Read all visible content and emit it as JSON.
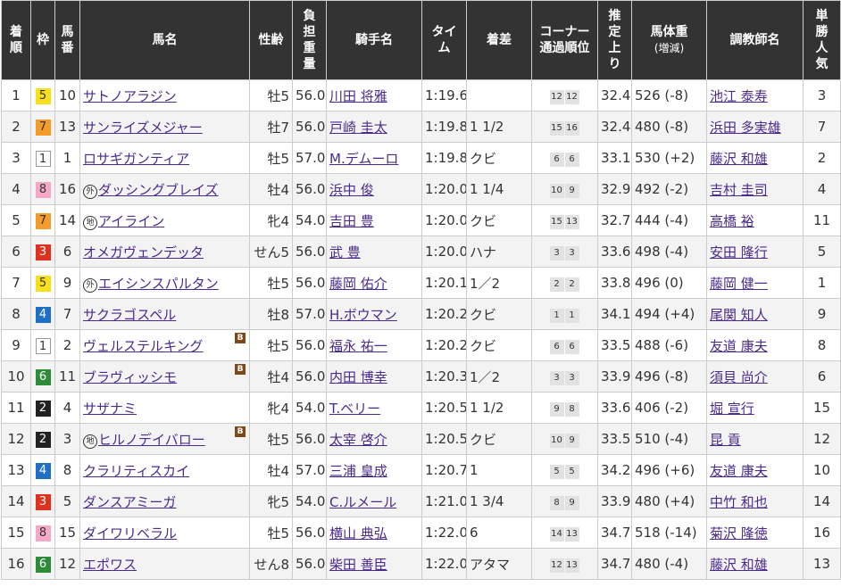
{
  "headers": {
    "rank": [
      "着",
      "順"
    ],
    "waku": [
      "枠"
    ],
    "umaban": [
      "馬",
      "番"
    ],
    "horse": [
      "馬名"
    ],
    "sexage": [
      "性齢"
    ],
    "weight": [
      "負",
      "担",
      "重",
      "量"
    ],
    "jockey": [
      "騎手名"
    ],
    "time": [
      "タイ",
      "ム"
    ],
    "margin": [
      "着差"
    ],
    "corner": [
      "コーナー",
      "通過順位"
    ],
    "last": [
      "推",
      "定",
      "上",
      "り"
    ],
    "body": [
      "馬体重",
      "(増減)"
    ],
    "trainer": [
      "調教師名"
    ],
    "pop": [
      "単",
      "勝",
      "人",
      "気"
    ]
  },
  "colors": {
    "header_bg": "#333333",
    "link": "#4b2a8c",
    "waku": {
      "1": "#ffffff",
      "2": "#222222",
      "3": "#e0301e",
      "4": "#1f6fc5",
      "5": "#f7e01a",
      "6": "#2e8b3a",
      "7": "#f39c2b",
      "8": "#f5a9c6"
    }
  },
  "rows": [
    {
      "rank": "1",
      "waku": "5",
      "umaban": "10",
      "mark": "",
      "horse": "サトノアラジン",
      "blinker": "",
      "sexage": "牡5",
      "weight": "56.0",
      "jockey": "川田 将雅",
      "time": "1:19.6",
      "margin": "",
      "corner": [
        "12",
        "12"
      ],
      "last": "32.4",
      "body": "526 (-8)",
      "trainer": "池江 泰寿",
      "pop": "3"
    },
    {
      "rank": "2",
      "waku": "7",
      "umaban": "13",
      "mark": "",
      "horse": "サンライズメジャー",
      "blinker": "",
      "sexage": "牡7",
      "weight": "56.0",
      "jockey": "戸崎 圭太",
      "time": "1:19.8",
      "margin": "1 1/2",
      "corner": [
        "15",
        "16"
      ],
      "last": "32.4",
      "body": "480 (-8)",
      "trainer": "浜田 多実雄",
      "pop": "7"
    },
    {
      "rank": "3",
      "waku": "1",
      "umaban": "1",
      "mark": "",
      "horse": "ロサギガンティア",
      "blinker": "",
      "sexage": "牡5",
      "weight": "57.0",
      "jockey": "M.デムーロ",
      "time": "1:19.8",
      "margin": "クビ",
      "corner": [
        "6",
        "6"
      ],
      "last": "33.1",
      "body": "530 (+2)",
      "trainer": "藤沢 和雄",
      "pop": "2"
    },
    {
      "rank": "4",
      "waku": "8",
      "umaban": "16",
      "mark": "外",
      "horse": "ダッシングブレイズ",
      "blinker": "",
      "sexage": "牡4",
      "weight": "56.0",
      "jockey": "浜中 俊",
      "time": "1:20.0",
      "margin": "1 1/4",
      "corner": [
        "10",
        "9"
      ],
      "last": "32.9",
      "body": "492 (-2)",
      "trainer": "吉村 圭司",
      "pop": "4"
    },
    {
      "rank": "5",
      "waku": "7",
      "umaban": "14",
      "mark": "地",
      "horse": "アイライン",
      "blinker": "",
      "sexage": "牝4",
      "weight": "54.0",
      "jockey": "吉田 豊",
      "time": "1:20.0",
      "margin": "クビ",
      "corner": [
        "15",
        "13"
      ],
      "last": "32.7",
      "body": "444 (-4)",
      "trainer": "高橋 裕",
      "pop": "11"
    },
    {
      "rank": "6",
      "waku": "3",
      "umaban": "6",
      "mark": "",
      "horse": "オメガヴェンデッタ",
      "blinker": "",
      "sexage": "せん5",
      "weight": "56.0",
      "jockey": "武 豊",
      "time": "1:20.0",
      "margin": "ハナ",
      "corner": [
        "3",
        "3"
      ],
      "last": "33.6",
      "body": "498 (-4)",
      "trainer": "安田 隆行",
      "pop": "5"
    },
    {
      "rank": "7",
      "waku": "5",
      "umaban": "9",
      "mark": "外",
      "horse": "エイシンスパルタン",
      "blinker": "",
      "sexage": "牡5",
      "weight": "56.0",
      "jockey": "藤岡 佑介",
      "time": "1:20.1",
      "margin": "1／2",
      "corner": [
        "2",
        "2"
      ],
      "last": "33.8",
      "body": "496 (0)",
      "trainer": "藤岡 健一",
      "pop": "1"
    },
    {
      "rank": "8",
      "waku": "4",
      "umaban": "7",
      "mark": "",
      "horse": "サクラゴスペル",
      "blinker": "",
      "sexage": "牡8",
      "weight": "57.0",
      "jockey": "H.ボウマン",
      "time": "1:20.2",
      "margin": "クビ",
      "corner": [
        "1",
        "1"
      ],
      "last": "34.1",
      "body": "494 (+4)",
      "trainer": "尾関 知人",
      "pop": "9"
    },
    {
      "rank": "9",
      "waku": "1",
      "umaban": "2",
      "mark": "",
      "horse": "ヴェルステルキング",
      "blinker": "B",
      "sexage": "牡5",
      "weight": "56.0",
      "jockey": "福永 祐一",
      "time": "1:20.2",
      "margin": "クビ",
      "corner": [
        "6",
        "6"
      ],
      "last": "33.5",
      "body": "488 (-6)",
      "trainer": "友道 康夫",
      "pop": "8"
    },
    {
      "rank": "10",
      "waku": "6",
      "umaban": "11",
      "mark": "",
      "horse": "ブラヴィッシモ",
      "blinker": "B",
      "sexage": "牡4",
      "weight": "56.0",
      "jockey": "内田 博幸",
      "time": "1:20.3",
      "margin": "1／2",
      "corner": [
        "3",
        "3"
      ],
      "last": "33.9",
      "body": "496 (-8)",
      "trainer": "須貝 尚介",
      "pop": "6"
    },
    {
      "rank": "11",
      "waku": "2",
      "umaban": "4",
      "mark": "",
      "horse": "サザナミ",
      "blinker": "",
      "sexage": "牝4",
      "weight": "54.0",
      "jockey": "T.ベリー",
      "time": "1:20.5",
      "margin": "1 1/2",
      "corner": [
        "9",
        "8"
      ],
      "last": "33.6",
      "body": "406 (-2)",
      "trainer": "堀 宣行",
      "pop": "15"
    },
    {
      "rank": "12",
      "waku": "2",
      "umaban": "3",
      "mark": "地",
      "horse": "ヒルノデイバロー",
      "blinker": "B",
      "sexage": "牡5",
      "weight": "56.0",
      "jockey": "太宰 啓介",
      "time": "1:20.5",
      "margin": "クビ",
      "corner": [
        "10",
        "9"
      ],
      "last": "33.5",
      "body": "510 (-4)",
      "trainer": "昆 貢",
      "pop": "12"
    },
    {
      "rank": "13",
      "waku": "4",
      "umaban": "8",
      "mark": "",
      "horse": "クラリティスカイ",
      "blinker": "",
      "sexage": "牡4",
      "weight": "57.0",
      "jockey": "三浦 皇成",
      "time": "1:20.7",
      "margin": "1",
      "corner": [
        "5",
        "5"
      ],
      "last": "34.2",
      "body": "496 (+6)",
      "trainer": "友道 康夫",
      "pop": "10"
    },
    {
      "rank": "14",
      "waku": "3",
      "umaban": "5",
      "mark": "",
      "horse": "ダンスアミーガ",
      "blinker": "",
      "sexage": "牝5",
      "weight": "54.0",
      "jockey": "C.ルメール",
      "time": "1:21.0",
      "margin": "1 3/4",
      "corner": [
        "8",
        "9"
      ],
      "last": "33.9",
      "body": "480 (+4)",
      "trainer": "中竹 和也",
      "pop": "14"
    },
    {
      "rank": "15",
      "waku": "8",
      "umaban": "15",
      "mark": "",
      "horse": "ダイワリベラル",
      "blinker": "",
      "sexage": "牡5",
      "weight": "56.0",
      "jockey": "横山 典弘",
      "time": "1:22.0",
      "margin": "6",
      "corner": [
        "14",
        "13"
      ],
      "last": "34.7",
      "body": "518 (-14)",
      "trainer": "菊沢 隆徳",
      "pop": "16"
    },
    {
      "rank": "16",
      "waku": "6",
      "umaban": "12",
      "mark": "",
      "horse": "エポワス",
      "blinker": "",
      "sexage": "せん8",
      "weight": "56.0",
      "jockey": "柴田 善臣",
      "time": "1:22.0",
      "margin": "アタマ",
      "corner": [
        "12",
        "13"
      ],
      "last": "34.7",
      "body": "480 (-4)",
      "trainer": "藤沢 和雄",
      "pop": "13"
    }
  ]
}
